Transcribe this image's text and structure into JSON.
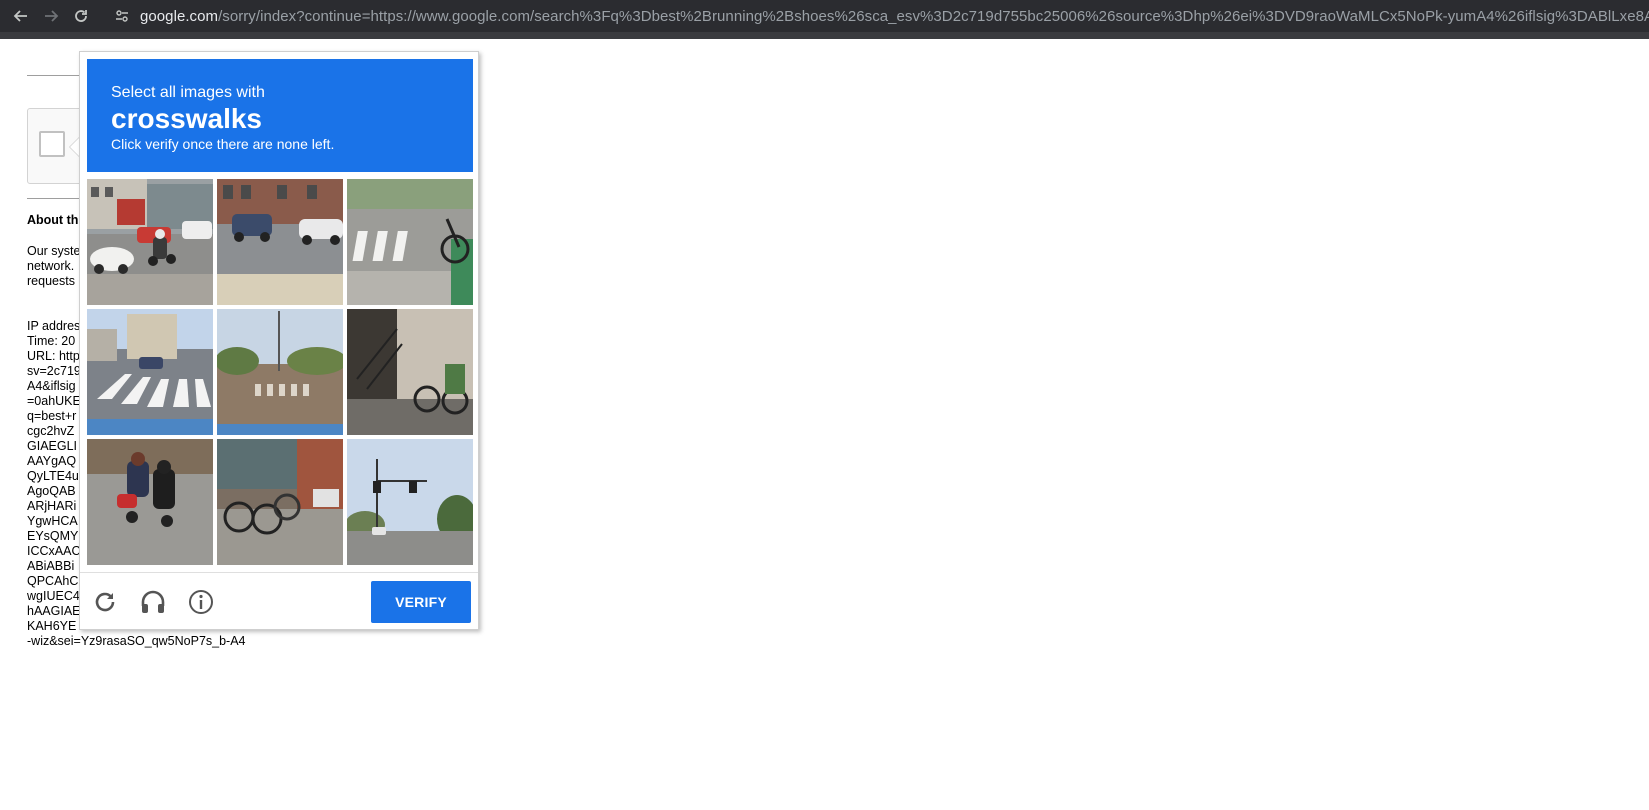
{
  "browser": {
    "url_host": "google.com",
    "url_rest": "/sorry/index?continue=https://www.google.com/search%3Fq%3Dbest%2Brunning%2Bshoes%26sca_esv%3D2c719d755bc25006%26source%3Dhp%26ei%3DVD9raoWaMLCx5NoPk-yumA4%26iflsig%3DABlLxe8A"
  },
  "page": {
    "about_heading": "About th",
    "para_lines": [
      "Our syste",
      "network.",
      "requests"
    ],
    "info_lines": [
      "IP addres",
      "Time: 20",
      "URL: http",
      "sv=2c719",
      "A4&iflsig",
      "=0ahUKE",
      "q=best+r",
      "cgc2hvZ",
      "GIAEGLI",
      "AAYgAQ",
      "QyLTE4u",
      "AgoQAB",
      "ARjHARi",
      "YgwHCA",
      "EYsQMY",
      "ICCxAAC",
      "ABiABBi",
      "QPCAhC",
      "wgIUEC4",
      "hAAGIAE",
      "KAH6YE",
      "-wiz&sei=Yz9rasaSO_qw5NoP7s_b-A4"
    ]
  },
  "captcha": {
    "instruction": "Select all images with",
    "target": "crosswalks",
    "subtext": "Click verify once there are none left.",
    "verify_label": "VERIFY",
    "tiles": [
      {
        "name": "tile-street-cars-motorcycle"
      },
      {
        "name": "tile-street-parked-cars"
      },
      {
        "name": "tile-crosswalk-bicycle"
      },
      {
        "name": "tile-crosswalk-intersection"
      },
      {
        "name": "tile-road-crosswalk-trees"
      },
      {
        "name": "tile-stairs-bicycle"
      },
      {
        "name": "tile-motorcycles-road"
      },
      {
        "name": "tile-bicycles-sidewalk"
      },
      {
        "name": "tile-traffic-light-road"
      }
    ],
    "icons": [
      "reload-icon",
      "headphones-icon",
      "info-icon"
    ],
    "colors": {
      "accent": "#1a73e8"
    }
  }
}
